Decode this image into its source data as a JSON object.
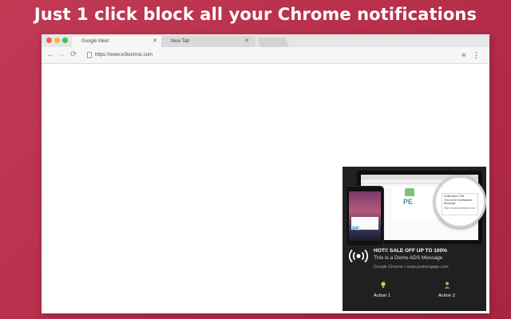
{
  "headline": "Just 1 click block all your Chrome notifications",
  "browser": {
    "tabs": [
      {
        "label": "Google Meet",
        "active": true
      },
      {
        "label": "New Tab",
        "active": false
      }
    ],
    "close_glyph": "✕",
    "address": "https://www.w3technic.com",
    "icons": {
      "back": "←",
      "forward": "→",
      "reload": "⟳",
      "star": "★",
      "menu": "⋮"
    }
  },
  "notification_preview": {
    "zoom_card": {
      "title": "Notification Title",
      "line1": "This is the Notification",
      "line2": "Message",
      "url": "http://www.example.com"
    },
    "brand_mark": "PE",
    "title": "HOT!! SALE OFF UP TO 100%",
    "message": "This is a Demo ADS Message",
    "source": "Google Chrome • www.pushengage.com",
    "icon": "broadcast-icon",
    "actions": [
      {
        "label": "Action 1",
        "icon": "bulb-icon"
      },
      {
        "label": "Action 2",
        "icon": "person-icon"
      }
    ]
  },
  "colors": {
    "background": "#b8304c",
    "notification_bg": "#202020"
  }
}
